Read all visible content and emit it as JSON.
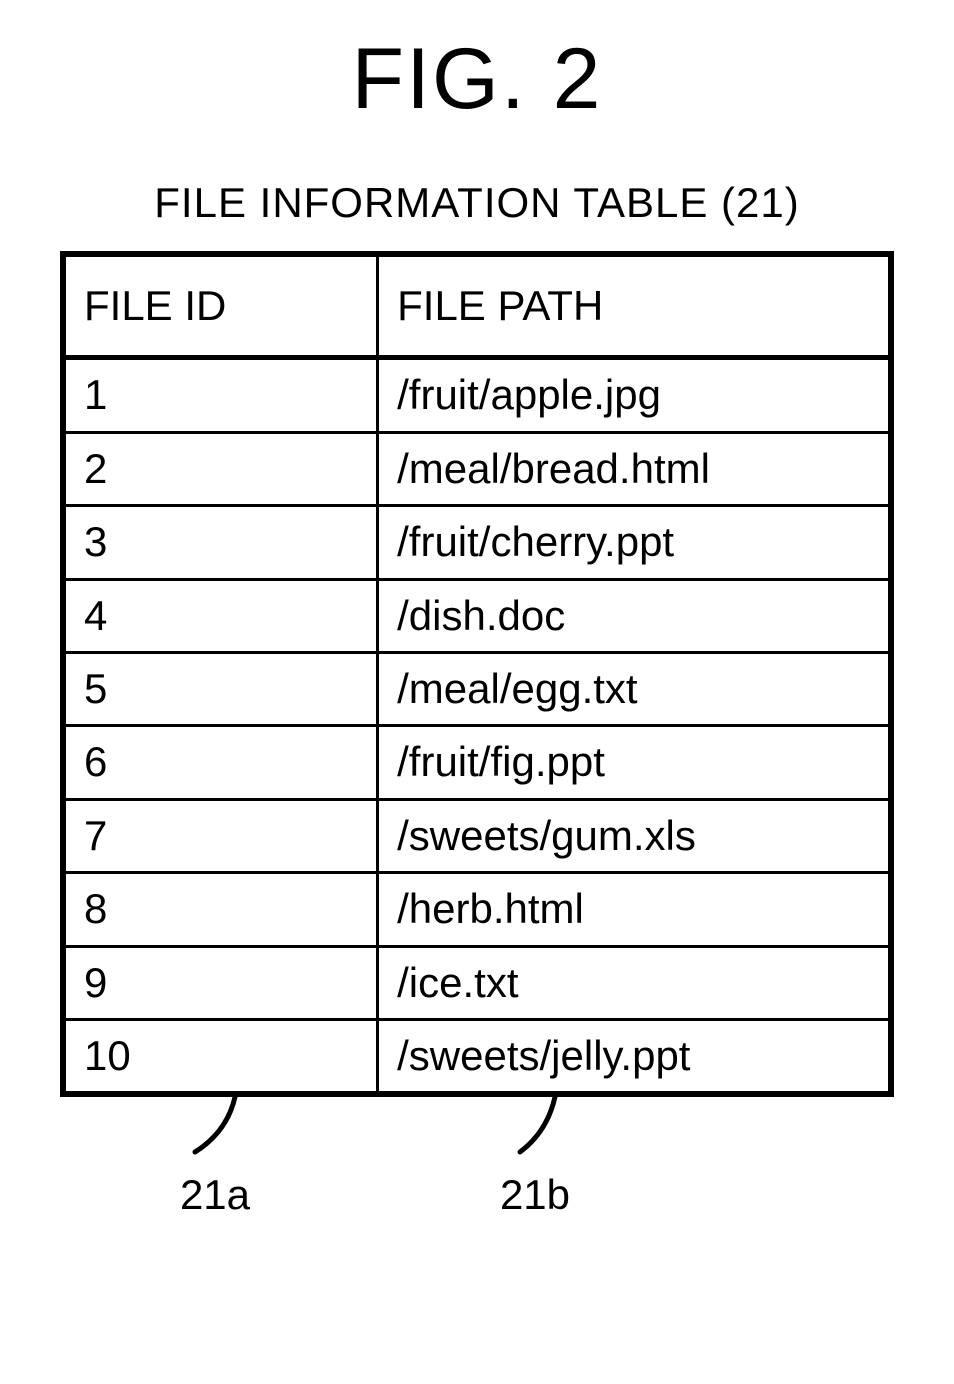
{
  "figure_label": "FIG. 2",
  "table_title": "FILE INFORMATION TABLE (21)",
  "columns": {
    "id": "FILE ID",
    "path": "FILE PATH"
  },
  "chart_data": {
    "type": "table",
    "columns": [
      "FILE ID",
      "FILE PATH"
    ],
    "rows": [
      {
        "id": "1",
        "path": "/fruit/apple.jpg"
      },
      {
        "id": "2",
        "path": "/meal/bread.html"
      },
      {
        "id": "3",
        "path": "/fruit/cherry.ppt"
      },
      {
        "id": "4",
        "path": "/dish.doc"
      },
      {
        "id": "5",
        "path": "/meal/egg.txt"
      },
      {
        "id": "6",
        "path": "/fruit/fig.ppt"
      },
      {
        "id": "7",
        "path": "/sweets/gum.xls"
      },
      {
        "id": "8",
        "path": "/herb.html"
      },
      {
        "id": "9",
        "path": "/ice.txt"
      },
      {
        "id": "10",
        "path": "/sweets/jelly.ppt"
      }
    ]
  },
  "callouts": {
    "a": "21a",
    "b": "21b"
  }
}
